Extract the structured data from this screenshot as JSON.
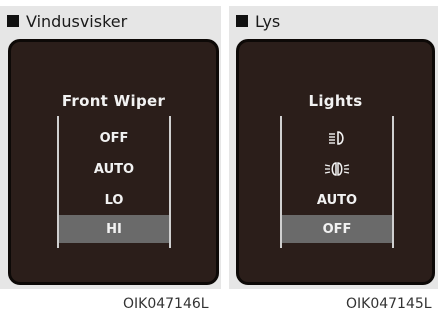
{
  "left_panel": {
    "header": "Vindusvisker",
    "title": "Front Wiper",
    "items": [
      "OFF",
      "AUTO",
      "LO",
      "HI"
    ],
    "selected": "HI",
    "caption": "OIK047146L"
  },
  "right_panel": {
    "header": "Lys",
    "title": "Lights",
    "items": [
      {
        "icon": "headlight-icon"
      },
      {
        "icon": "parking-light-icon"
      },
      {
        "label": "AUTO"
      },
      {
        "label": "OFF"
      }
    ],
    "selected": "OFF",
    "caption": "OIK047145L"
  },
  "colors": {
    "screen_bg": "#2b1e1a",
    "selected_bg": "#6a6a6a",
    "panel_bg": "#e6e6e6"
  }
}
